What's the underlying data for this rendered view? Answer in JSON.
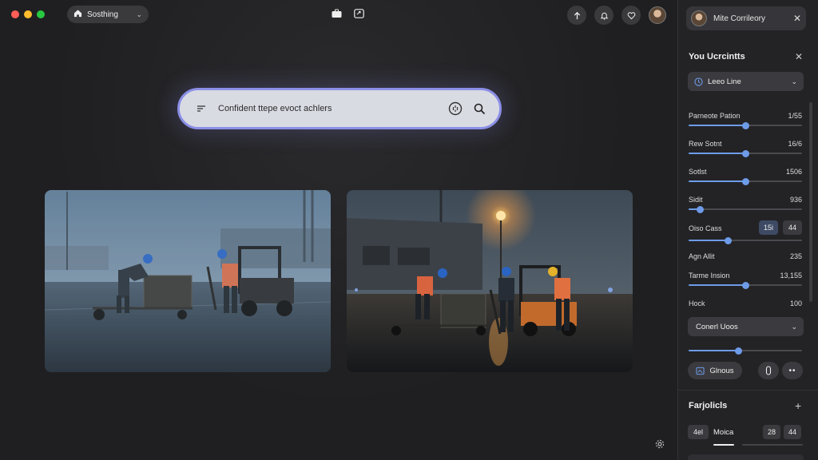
{
  "window": {
    "tab_label": "Sosthing"
  },
  "search": {
    "placeholder": "Confident ttepe evoct achlers"
  },
  "photos": [
    {
      "name": "workers-rainy-warehouse-blue"
    },
    {
      "name": "workers-rainy-warehouse-night-light"
    }
  ],
  "panel": {
    "user_name": "Mite Corrileory",
    "section_title": "You Ucrcintts",
    "preset_dropdown": "Leeo Line",
    "sliders": [
      {
        "label": "Parneote Pation",
        "value": "1/55",
        "level": 0.5
      },
      {
        "label": "Rew Sotnt",
        "value": "16/6",
        "level": 0.5
      },
      {
        "label": "Sotlst",
        "value": "1506",
        "level": 0.5
      },
      {
        "label": "Sidit",
        "value": "936",
        "level": 0.1
      },
      {
        "label": "Oiso Cass",
        "value": "",
        "level": 0.35,
        "boxes": [
          "15i",
          "44"
        ]
      }
    ],
    "agn_label": "Agn Allit",
    "agn_value": "235",
    "tarme": {
      "label": "Tarme Insion",
      "value": "13,155",
      "level": 0.5
    },
    "hock_label": "Hock",
    "hock_value": "100",
    "mode_dropdown": "Conerl Uoos",
    "mode_slider_level": 0.44,
    "action_label": "Glnous",
    "section2_title": "Farjolicls",
    "bottom_row": {
      "box_a": "4el",
      "label": "Moica",
      "box_b": "28",
      "box_c": "44"
    }
  },
  "colors": {
    "accent": "#6e9be8",
    "search_border": "#8b8fe6"
  }
}
